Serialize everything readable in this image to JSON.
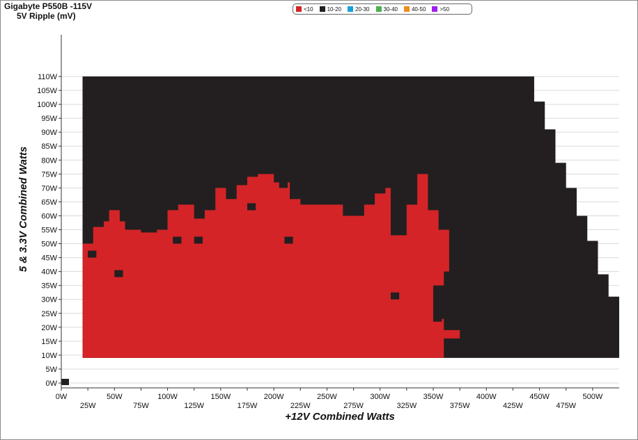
{
  "chart_data": {
    "type": "heatmap",
    "title": "Gigabyte P550B -115V",
    "subtitle": "5V Ripple (mV)",
    "xlabel": "+12V Combined Watts",
    "ylabel": "5 & 3.3V Combined Watts",
    "xlim": [
      0,
      525
    ],
    "ylim": [
      0,
      115
    ],
    "x_ticks_upper": [
      "0W",
      "50W",
      "100W",
      "150W",
      "200W",
      "250W",
      "300W",
      "350W",
      "400W",
      "450W",
      "500W"
    ],
    "x_ticks_lower": [
      "25W",
      "75W",
      "125W",
      "175W",
      "225W",
      "275W",
      "325W",
      "375W",
      "425W",
      "475W"
    ],
    "y_ticks": [
      "0W",
      "5W",
      "10W",
      "15W",
      "20W",
      "25W",
      "30W",
      "35W",
      "40W",
      "45W",
      "50W",
      "55W",
      "60W",
      "65W",
      "70W",
      "75W",
      "80W",
      "85W",
      "90W",
      "95W",
      "100W",
      "105W",
      "110W"
    ],
    "legend": [
      {
        "label": "<10",
        "color": "#d42428"
      },
      {
        "label": "10-20",
        "color": "#231f20"
      },
      {
        "label": "20-30",
        "color": "#1aa0d8"
      },
      {
        "label": "30-40",
        "color": "#4cb050"
      },
      {
        "label": "40-50",
        "color": "#f08c1e"
      },
      {
        "label": ">50",
        "color": "#a020f0"
      }
    ],
    "grid": true,
    "cells": {
      "x_step_w": 5,
      "y_step_w": 5,
      "origin_point": {
        "x": 0,
        "y": 0,
        "range": "10-20"
      },
      "region_10_20_outer_boundary": [
        [
          20,
          110
        ],
        [
          445,
          110
        ],
        [
          445,
          101
        ],
        [
          455,
          101
        ],
        [
          455,
          91
        ],
        [
          465,
          91
        ],
        [
          465,
          79
        ],
        [
          475,
          79
        ],
        [
          475,
          70
        ],
        [
          485,
          70
        ],
        [
          485,
          60
        ],
        [
          495,
          60
        ],
        [
          495,
          51
        ],
        [
          505,
          51
        ],
        [
          505,
          39
        ],
        [
          515,
          39
        ],
        [
          515,
          31
        ],
        [
          525,
          31
        ],
        [
          525,
          9
        ],
        [
          20,
          9
        ]
      ],
      "region_lt10_boundary": [
        [
          20,
          9
        ],
        [
          20,
          50
        ],
        [
          30,
          50
        ],
        [
          30,
          56
        ],
        [
          40,
          56
        ],
        [
          40,
          58
        ],
        [
          45,
          58
        ],
        [
          45,
          62
        ],
        [
          55,
          62
        ],
        [
          55,
          58
        ],
        [
          60,
          58
        ],
        [
          60,
          55
        ],
        [
          75,
          55
        ],
        [
          75,
          54
        ],
        [
          90,
          54
        ],
        [
          90,
          55
        ],
        [
          100,
          55
        ],
        [
          100,
          62
        ],
        [
          110,
          62
        ],
        [
          110,
          64
        ],
        [
          125,
          64
        ],
        [
          125,
          59
        ],
        [
          135,
          59
        ],
        [
          135,
          62
        ],
        [
          145,
          62
        ],
        [
          145,
          70
        ],
        [
          155,
          70
        ],
        [
          155,
          66
        ],
        [
          165,
          66
        ],
        [
          165,
          71
        ],
        [
          175,
          71
        ],
        [
          175,
          74
        ],
        [
          185,
          74
        ],
        [
          185,
          75
        ],
        [
          200,
          75
        ],
        [
          200,
          72
        ],
        [
          215,
          72
        ],
        [
          215,
          66
        ],
        [
          225,
          66
        ],
        [
          225,
          64
        ],
        [
          240,
          64
        ],
        [
          240,
          64
        ],
        [
          265,
          64
        ],
        [
          265,
          60
        ],
        [
          285,
          60
        ],
        [
          285,
          64
        ],
        [
          295,
          64
        ],
        [
          295,
          68
        ],
        [
          305,
          68
        ],
        [
          305,
          70
        ],
        [
          310,
          70
        ],
        [
          310,
          53
        ],
        [
          325,
          53
        ],
        [
          325,
          64
        ],
        [
          335,
          64
        ],
        [
          335,
          75
        ],
        [
          345,
          75
        ],
        [
          345,
          62
        ],
        [
          355,
          62
        ],
        [
          355,
          55
        ],
        [
          365,
          55
        ],
        [
          365,
          40
        ],
        [
          360,
          40
        ],
        [
          360,
          35
        ],
        [
          350,
          35
        ],
        [
          350,
          22
        ],
        [
          340,
          22
        ],
        [
          340,
          23
        ],
        [
          355,
          23
        ],
        [
          360,
          23
        ],
        [
          360,
          19
        ],
        [
          375,
          19
        ],
        [
          375,
          16
        ],
        [
          360,
          16
        ],
        [
          360,
          9
        ]
      ],
      "isolated_10_20_patches": [
        [
          25,
          45
        ],
        [
          50,
          38
        ],
        [
          90,
          58
        ],
        [
          105,
          50
        ],
        [
          125,
          50
        ],
        [
          175,
          62
        ],
        [
          210,
          50
        ],
        [
          205,
          70
        ],
        [
          310,
          30
        ],
        [
          350,
          22
        ]
      ]
    }
  }
}
